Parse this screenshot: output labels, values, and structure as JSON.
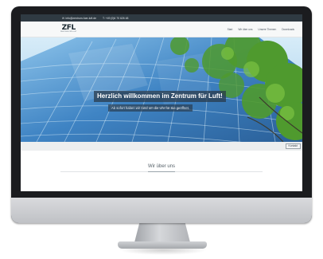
{
  "topbar": {
    "email": "info@zentrum-fuer-luft.de",
    "phone": "T: +49 (0)6 70 626 48"
  },
  "logo": {
    "mark": "ZFL",
    "subtitle": "ZENTRUM FÜR LUFT"
  },
  "nav": {
    "items": [
      "Start",
      "Wir über uns",
      "Unsere Themen",
      "Downloads"
    ]
  },
  "hero": {
    "title": "Herzlich willkommen im Zentrum für Luft!",
    "subtitle": "Ab sofort haben wir rund um die Uhr für Sie geöffnet."
  },
  "contact_button": "Kontakt",
  "section": {
    "heading": "Wir über uns"
  },
  "colors": {
    "topbar": "#2f3a42",
    "sky": "#3b7fc0",
    "foliage": "#4f9a2e"
  }
}
